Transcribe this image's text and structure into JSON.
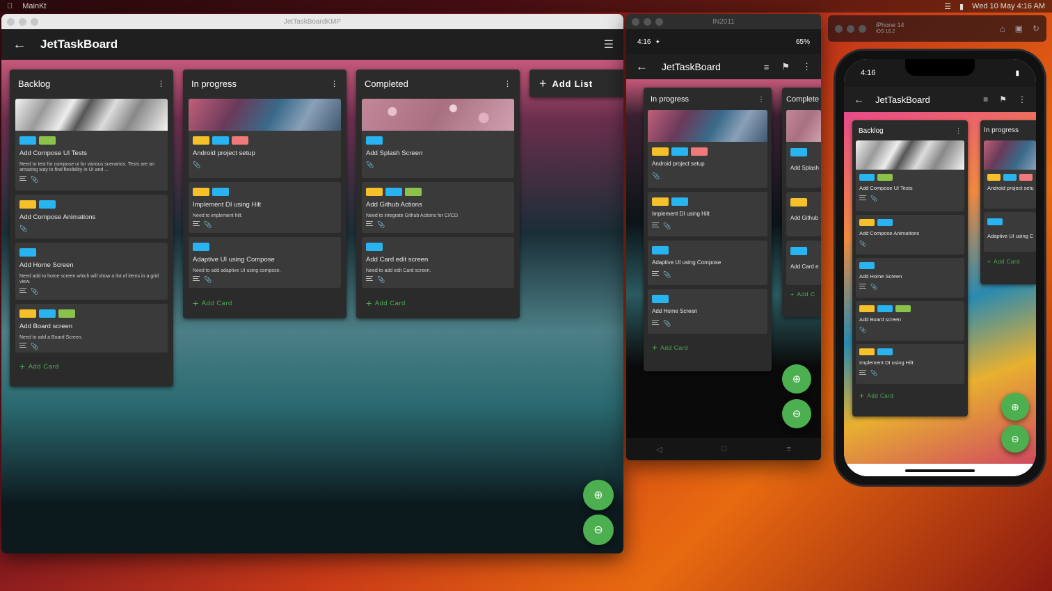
{
  "menubar": {
    "app": "MainKt",
    "datetime": "Wed 10 May 4:16 AM"
  },
  "desktop_window": {
    "title": "JetTaskBoardKMP",
    "app_title": "JetTaskBoard",
    "add_list": "Add List",
    "add_card": "Add Card",
    "columns": [
      {
        "name": "Backlog",
        "cards": [
          {
            "cover": "marble",
            "labels": [
              "#f5c02a",
              "#28b4f0"
            ],
            "title": "Add Compose UI Tests",
            "desc": "Need to test for compose ui for various scenarios. Tests are an amazing way to find flexibility in UI and ..."
          },
          {
            "labels": [
              "#f5c02a",
              "#28b4f0"
            ],
            "title": "Add Compose Animations",
            "desc": ""
          },
          {
            "labels": [
              "#28b4f0"
            ],
            "title": "Add Home Screen",
            "desc": "Need add to home screen which will show a list of items in a grid view."
          },
          {
            "labels": [
              "#f5c02a",
              "#28b4f0",
              "#8bc34a"
            ],
            "title": "Add Board screen",
            "desc": "Need to add a Board Screen."
          }
        ]
      },
      {
        "name": "In progress",
        "cards": [
          {
            "cover": "smoke",
            "labels": [
              "#f5c02a",
              "#28b4f0",
              "#f07a7a"
            ],
            "title": "Android project setup",
            "desc": ""
          },
          {
            "labels": [
              "#f5c02a",
              "#28b4f0"
            ],
            "title": "Implement DI using Hilt",
            "desc": "Need to implement hilt."
          },
          {
            "labels": [
              "#28b4f0"
            ],
            "title": "Adaptive UI using Compose",
            "desc": "Need to add adaptive UI using compose."
          }
        ]
      },
      {
        "name": "Completed",
        "cards": [
          {
            "cover": "bokeh",
            "labels": [
              "#28b4f0"
            ],
            "title": "Add Splash Screen",
            "desc": ""
          },
          {
            "labels": [
              "#f5c02a",
              "#28b4f0",
              "#8bc34a"
            ],
            "title": "Add Github Actions",
            "desc": "Need to integrate Github Actions for CI/CD."
          },
          {
            "labels": [
              "#28b4f0"
            ],
            "title": "Add Card edit screen",
            "desc": "Need to add edit Card screen."
          }
        ]
      }
    ]
  },
  "android_window": {
    "title": "IN2011",
    "status_time": "4:16",
    "battery": "65%",
    "app_title": "JetTaskBoard",
    "add_card": "Add Card",
    "col_in_progress": "In progress",
    "col_completed": "Complete",
    "cards": [
      "Android project setup",
      "Implement DI using Hilt",
      "Adaptive UI using Compose",
      "Add Home Screen"
    ],
    "completed_cards": [
      "Add Splash",
      "Add Github",
      "Add Card e"
    ],
    "completed_add": "Add C"
  },
  "ios_window": {
    "title": "iPhone 14",
    "subtitle": "iOS 16.2",
    "status_time": "4:16",
    "app_title": "JetTaskBoard",
    "add_card": "Add Card",
    "col_backlog": "Backlog",
    "col_in_progress": "In progress",
    "backlog_cards": [
      "Add Compose UI Tests",
      "Add Compose Animations",
      "Add Home Screen",
      "Add Board screen",
      "Implement DI using Hilt"
    ],
    "inprog_cards": [
      "Android project setu",
      "Adaptive UI using C"
    ]
  },
  "colors": {
    "accent": "#4caf50",
    "yellow": "#f5c02a",
    "blue": "#28b4f0",
    "green": "#8bc34a",
    "red": "#f07a7a"
  }
}
